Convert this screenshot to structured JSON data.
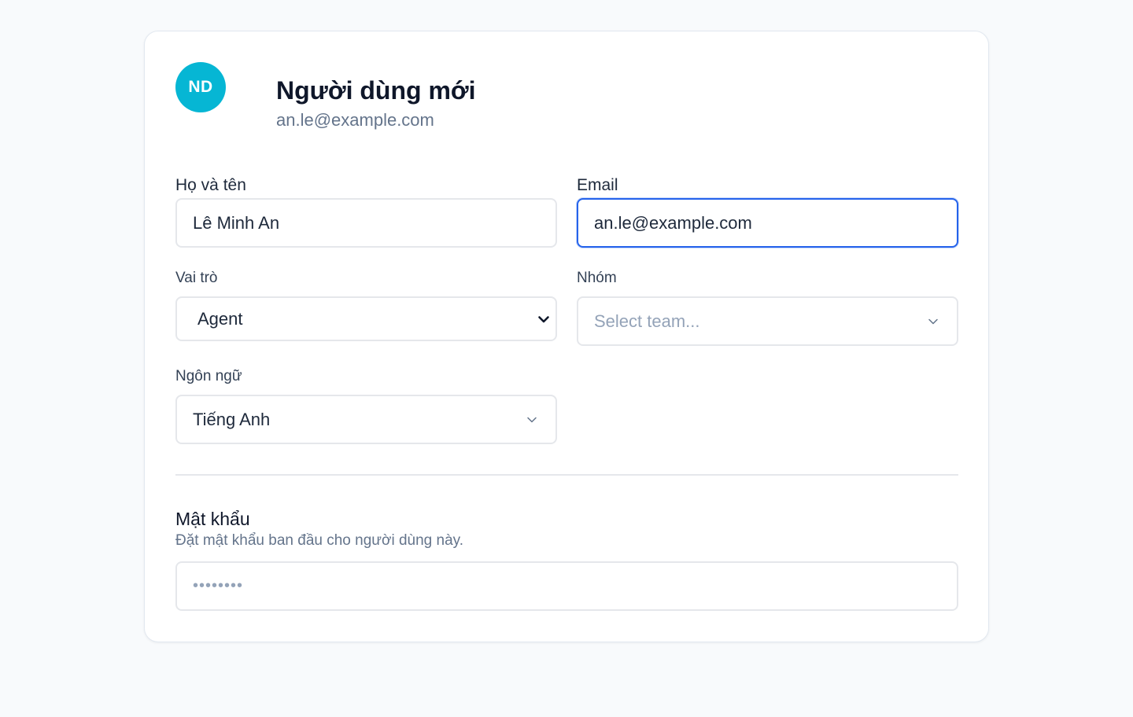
{
  "profile": {
    "initials": "ND",
    "title": "Người dùng mới",
    "email": "an.le@example.com"
  },
  "form": {
    "name_label": "Họ và tên",
    "name_value": "Lê Minh An",
    "email_label": "Email",
    "email_value": "an.le@example.com",
    "role_label": "Vai trò",
    "role_value": "Agent",
    "team_label": "Nhóm",
    "team_placeholder": "Select team...",
    "language_label": "Ngôn ngữ",
    "language_value": "Tiếng Anh"
  },
  "password": {
    "title": "Mật khẩu",
    "description": "Đặt mật khẩu ban đầu cho người dùng này.",
    "masked_value": "••••••••"
  },
  "colors": {
    "avatar": "#06b6d4",
    "focus": "#2563eb",
    "background": "#f8fafc"
  },
  "icons": {
    "role_select": "chevron-down-icon",
    "team_select": "chevron-down-icon",
    "language_select": "chevron-down-icon"
  }
}
